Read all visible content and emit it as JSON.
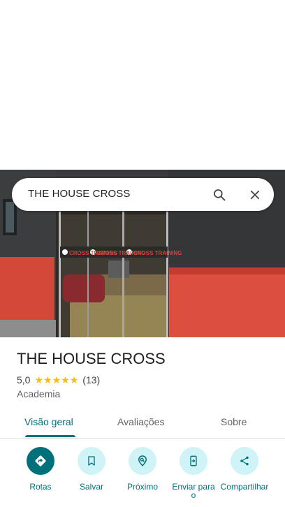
{
  "search": {
    "query": "THE HOUSE CROSS",
    "search_icon": "search-icon",
    "close_icon": "close-icon"
  },
  "hero": {
    "sign_texts": [
      "CROSS TRAINING",
      "CROSS TRAINING",
      "CROSS TRAINING"
    ]
  },
  "place": {
    "name": "THE HOUSE CROSS",
    "rating": "5,0",
    "stars": 5,
    "review_count": "(13)",
    "category": "Academia"
  },
  "tabs": [
    {
      "label": "Visão geral",
      "active": true
    },
    {
      "label": "Avaliações",
      "active": false
    },
    {
      "label": "Sobre",
      "active": false
    }
  ],
  "actions": [
    {
      "label": "Rotas",
      "icon": "directions-icon"
    },
    {
      "label": "Salvar",
      "icon": "bookmark-icon"
    },
    {
      "label": "Próximo",
      "icon": "nearby-icon"
    },
    {
      "label": "Enviar para o",
      "icon": "send-to-phone-icon"
    },
    {
      "label": "Compartilhar",
      "icon": "share-icon"
    }
  ],
  "colors": {
    "accent": "#00717a",
    "accent_light": "#cff3f7",
    "star": "#fbbc04"
  }
}
